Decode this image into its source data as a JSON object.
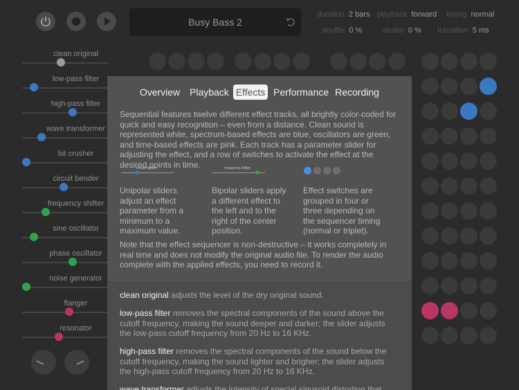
{
  "header": {
    "preset_title": "Busy Bass 2",
    "duration_label": "duration",
    "duration_value": "2 bars",
    "playback_label": "playback",
    "playback_value": "forward",
    "timing_label": "timing",
    "timing_value": "normal",
    "shuffle_label": "shuffle",
    "shuffle_value": "0 %",
    "strobo_label": "strobo",
    "strobo_value": "0 %",
    "transition_label": "transition",
    "transition_value": "5 ms",
    "icons": [
      "power-icon",
      "record-icon",
      "play-icon",
      "undo-icon"
    ]
  },
  "sliders": [
    {
      "label": "clean original",
      "value": 0.45,
      "color": "#9a9a9a"
    },
    {
      "label": "low-pass filter",
      "value": 0.1,
      "color": "#3a78c2"
    },
    {
      "label": "high-pass filter",
      "value": 0.6,
      "color": "#3a78c2"
    },
    {
      "label": "wave transformer",
      "value": 0.2,
      "color": "#3a78c2"
    },
    {
      "label": "bit crusher",
      "value": 0.0,
      "color": "#3a78c2"
    },
    {
      "label": "circuit bender",
      "value": 0.48,
      "color": "#3a78c2"
    },
    {
      "label": "frequency shifter",
      "value": 0.25,
      "color": "#2fa34a"
    },
    {
      "label": "sine oscillator",
      "value": 0.1,
      "color": "#2fa34a"
    },
    {
      "label": "phase oscillator",
      "value": 0.6,
      "color": "#2fa34a"
    },
    {
      "label": "noise generator",
      "value": 0.0,
      "color": "#2fa34a"
    },
    {
      "label": "flanger",
      "value": 0.55,
      "color": "#b83565"
    },
    {
      "label": "resonator",
      "value": 0.42,
      "color": "#b83565"
    }
  ],
  "help": {
    "tabs": [
      "Overview",
      "Playback",
      "Effects",
      "Performance",
      "Recording"
    ],
    "active_tab": "Effects",
    "intro": "Sequential features twelve different effect tracks, all brightly color-coded for quick and easy recognition – even from a distance. Clean sound is represented white, spectrum-based effects are blue, oscillators are green, and time-based effects are pink. Each track has a parameter slider for adjusting the effect, and a row of switches to activate the effect at the desired points in time.",
    "example_labels": {
      "unipolar": "circuit bender",
      "bipolar": "frequency shifter"
    },
    "columns": [
      "Unipolar sliders adjust an effect parameter from a minimum to a maximum value.",
      "Bipolar sliders apply a different effect to the left and to the right of the center position.",
      "Effect switches are grouped in four or three depending on the sequencer timing (normal or triplet)."
    ],
    "note": "Note that the effect sequencer is non-destructive – it works completely in real time and does not modify the original audio file. To render the audio complete with the applied effects, you need to record it.",
    "entries": [
      {
        "name": "clean original",
        "text": " adjusts the level of the dry original sound."
      },
      {
        "name": "low-pass filter",
        "text": " removes the spectral components of the sound above the cutoff frequency, making the sound deeper and darker; the slider adjusts the low-pass cutoff frequency from 20 Hz to 16 KHz."
      },
      {
        "name": "high-pass filter",
        "text": " removes the spectral components of the sound below the cutoff frequency, making the sound lighter and brigher; the slider adjusts the high-pass cutoff frequency from 20 Hz to 16 KHz."
      },
      {
        "name": "wave transformer",
        "text": " adjusts the intensity of special sinusoid distortion that “curls” the"
      }
    ]
  },
  "colors": {
    "blue": "#3a78c2",
    "green": "#2fa34a",
    "pink": "#b83565",
    "white": "#9a9a9a"
  }
}
